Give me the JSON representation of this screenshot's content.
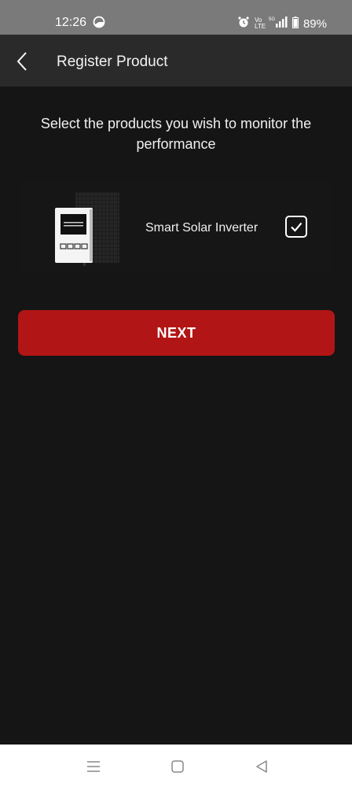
{
  "status_bar": {
    "time": "12:26",
    "battery": "89%",
    "icons": [
      "sync-icon",
      "alarm-icon",
      "volte-icon",
      "signal-icon",
      "battery-icon"
    ]
  },
  "header": {
    "title": "Register Product",
    "back_icon": "chevron-left-icon"
  },
  "main": {
    "subtitle": "Select the products you wish to monitor the performance",
    "products": [
      {
        "name": "Smart Solar Inverter",
        "checked": true,
        "icon": "solar-inverter-image"
      }
    ],
    "next_label": "NEXT"
  },
  "nav_bar": {
    "buttons": [
      "menu-icon",
      "home-icon",
      "back-icon"
    ]
  },
  "colors": {
    "accent": "#b21515",
    "background": "#151515",
    "header": "#2a2a2a",
    "status_bar": "#7a7a7a"
  }
}
